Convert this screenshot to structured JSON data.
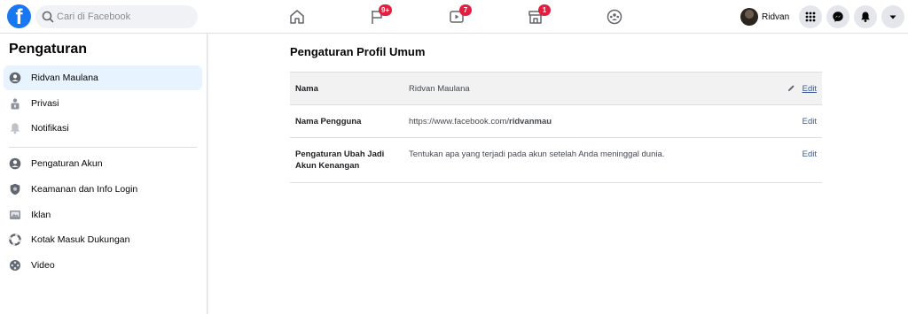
{
  "search": {
    "placeholder": "Cari di Facebook"
  },
  "nav": {
    "badges": {
      "pages": "9+",
      "watch": "7",
      "marketplace": "1"
    }
  },
  "profile": {
    "name": "Ridvan"
  },
  "sidebar": {
    "title": "Pengaturan",
    "items": [
      {
        "label": "Ridvan Maulana",
        "icon": "user-circle-icon"
      },
      {
        "label": "Privasi",
        "icon": "lock-person-icon"
      },
      {
        "label": "Notifikasi",
        "icon": "bell-icon"
      },
      {
        "label": "Pengaturan Akun",
        "icon": "user-circle-icon"
      },
      {
        "label": "Keamanan dan Info Login",
        "icon": "shield-icon"
      },
      {
        "label": "Iklan",
        "icon": "ad-icon"
      },
      {
        "label": "Kotak Masuk Dukungan",
        "icon": "lifebuoy-icon"
      },
      {
        "label": "Video",
        "icon": "film-reel-icon"
      }
    ]
  },
  "main": {
    "title": "Pengaturan Profil Umum",
    "rows": [
      {
        "label": "Nama",
        "value": "Ridvan Maulana",
        "edit": "Edit"
      },
      {
        "label": "Nama Pengguna",
        "value_prefix": "https://www.facebook.com/",
        "value_bold": "ridvanmau",
        "edit": "Edit"
      },
      {
        "label": "Pengaturan Ubah Jadi Akun Kenangan",
        "value": "Tentukan apa yang terjadi pada akun setelah Anda meninggal dunia.",
        "edit": "Edit"
      }
    ]
  },
  "colors": {
    "brand": "#1877f2",
    "badge": "#e41e3f",
    "link": "#385898",
    "active_bg": "#e7f3ff"
  }
}
